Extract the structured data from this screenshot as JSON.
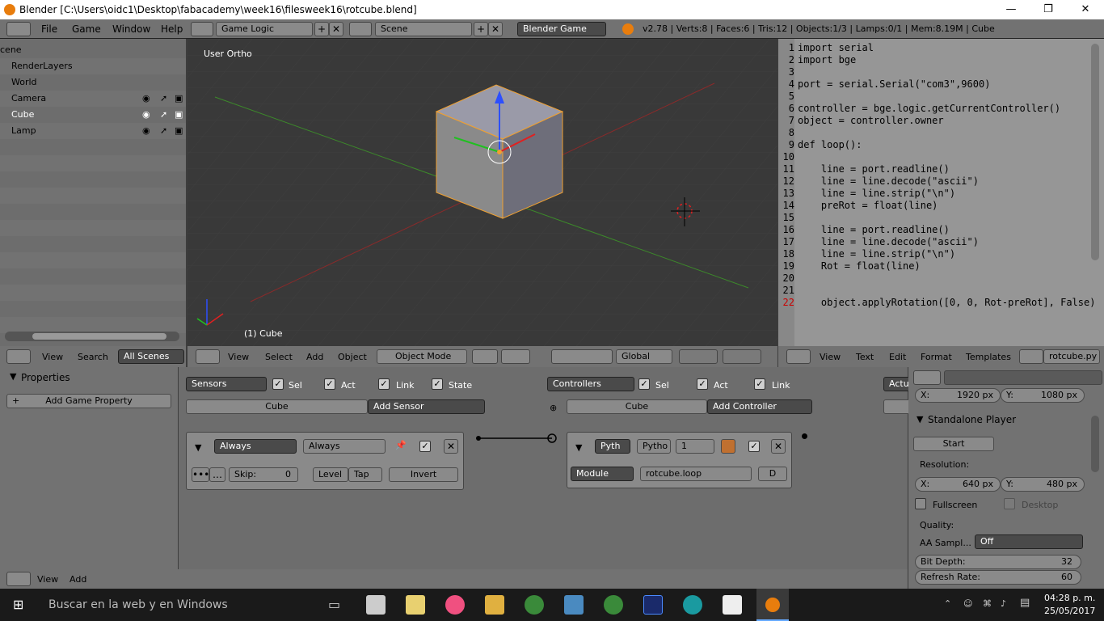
{
  "window": {
    "title": "Blender [C:\\Users\\oidc1\\Desktop\\fabacademy\\week16\\filesweek16\\rotcube.blend]",
    "minimize": "—",
    "maximize": "❐",
    "close": "✕"
  },
  "menubar": {
    "items": [
      "File",
      "Game",
      "Window",
      "Help"
    ],
    "screen": "Game Logic",
    "scene": "Scene",
    "engine": "Blender Game",
    "stats": "v2.78 | Verts:8 | Faces:6 | Tris:12 | Objects:1/3 | Lamps:0/1 | Mem:8.19M | Cube"
  },
  "outliner": {
    "items": [
      {
        "label": "cene"
      },
      {
        "label": "RenderLayers"
      },
      {
        "label": "World"
      },
      {
        "label": "Camera"
      },
      {
        "label": "Cube"
      },
      {
        "label": "Lamp"
      }
    ],
    "header": {
      "view": "View",
      "search": "Search",
      "filter": "All Scenes"
    }
  },
  "viewport": {
    "label": "User Ortho",
    "object_label": "(1) Cube",
    "header": {
      "view": "View",
      "select": "Select",
      "add": "Add",
      "object": "Object",
      "mode": "Object Mode",
      "orientation": "Global"
    }
  },
  "text_editor": {
    "lines": [
      {
        "n": "1",
        "t": "import serial"
      },
      {
        "n": "2",
        "t": "import bge"
      },
      {
        "n": "3",
        "t": ""
      },
      {
        "n": "4",
        "t": "port = serial.Serial(\"com3\",9600)"
      },
      {
        "n": "5",
        "t": ""
      },
      {
        "n": "6",
        "t": "controller = bge.logic.getCurrentController()"
      },
      {
        "n": "7",
        "t": "object = controller.owner"
      },
      {
        "n": "8",
        "t": ""
      },
      {
        "n": "9",
        "t": "def loop():"
      },
      {
        "n": "10",
        "t": ""
      },
      {
        "n": "11",
        "t": "    line = port.readline()"
      },
      {
        "n": "12",
        "t": "    line = line.decode(\"ascii\")"
      },
      {
        "n": "13",
        "t": "    line = line.strip(\"\\n\")"
      },
      {
        "n": "14",
        "t": "    preRot = float(line)"
      },
      {
        "n": "15",
        "t": ""
      },
      {
        "n": "16",
        "t": "    line = port.readline()"
      },
      {
        "n": "17",
        "t": "    line = line.decode(\"ascii\")"
      },
      {
        "n": "18",
        "t": "    line = line.strip(\"\\n\")"
      },
      {
        "n": "19",
        "t": "    Rot = float(line)"
      },
      {
        "n": "20",
        "t": ""
      },
      {
        "n": "21",
        "t": ""
      },
      {
        "n": "22",
        "t": "    object.applyRotation([0, 0, Rot-preRot], False)"
      }
    ],
    "header": {
      "view": "View",
      "text": "Text",
      "edit": "Edit",
      "format": "Format",
      "templates": "Templates",
      "file": "rotcube.py"
    }
  },
  "properties": {
    "title": "Properties",
    "add_prop": "Add Game Property"
  },
  "logic": {
    "sensors": {
      "menu": "Sensors",
      "sel": "Sel",
      "act": "Act",
      "link": "Link",
      "state": "State",
      "object": "Cube",
      "add": "Add Sensor",
      "brick": {
        "type": "Always",
        "name": "Always",
        "skip_label": "Skip:",
        "skip_value": "0",
        "level": "Level",
        "tap": "Tap",
        "invert": "Invert"
      }
    },
    "controllers": {
      "menu": "Controllers",
      "sel": "Sel",
      "act": "Act",
      "link": "Link",
      "object": "Cube",
      "add": "Add Controller",
      "brick": {
        "type": "Pyth",
        "name": "Pytho",
        "state": "1",
        "mode": "Module",
        "module": "rotcube.loop",
        "debug": "D"
      }
    },
    "actuators": {
      "menu": "Actu"
    },
    "header": {
      "view": "View",
      "add": "Add"
    }
  },
  "render": {
    "res_x_label": "X:",
    "res_x": "1920 px",
    "res_y_label": "Y:",
    "res_y": "1080 px",
    "standalone": "Standalone Player",
    "start": "Start",
    "resolution": "Resolution:",
    "sx_label": "X:",
    "sx": "640 px",
    "sy_label": "Y:",
    "sy": "480 px",
    "fullscreen": "Fullscreen",
    "desktop": "Desktop",
    "quality": "Quality:",
    "aa_label": "AA Sampl...",
    "aa_value": "Off",
    "bitdepth_label": "Bit Depth:",
    "bitdepth": "32",
    "refresh_label": "Refresh Rate:",
    "refresh": "60"
  },
  "taskbar": {
    "search": "Buscar en la web y en Windows",
    "time": "04:28 p. m.",
    "date": "25/05/2017"
  },
  "colors": {
    "accent": "#e87d0d",
    "viewport_bg": "#393939",
    "text_bg": "#969696"
  }
}
